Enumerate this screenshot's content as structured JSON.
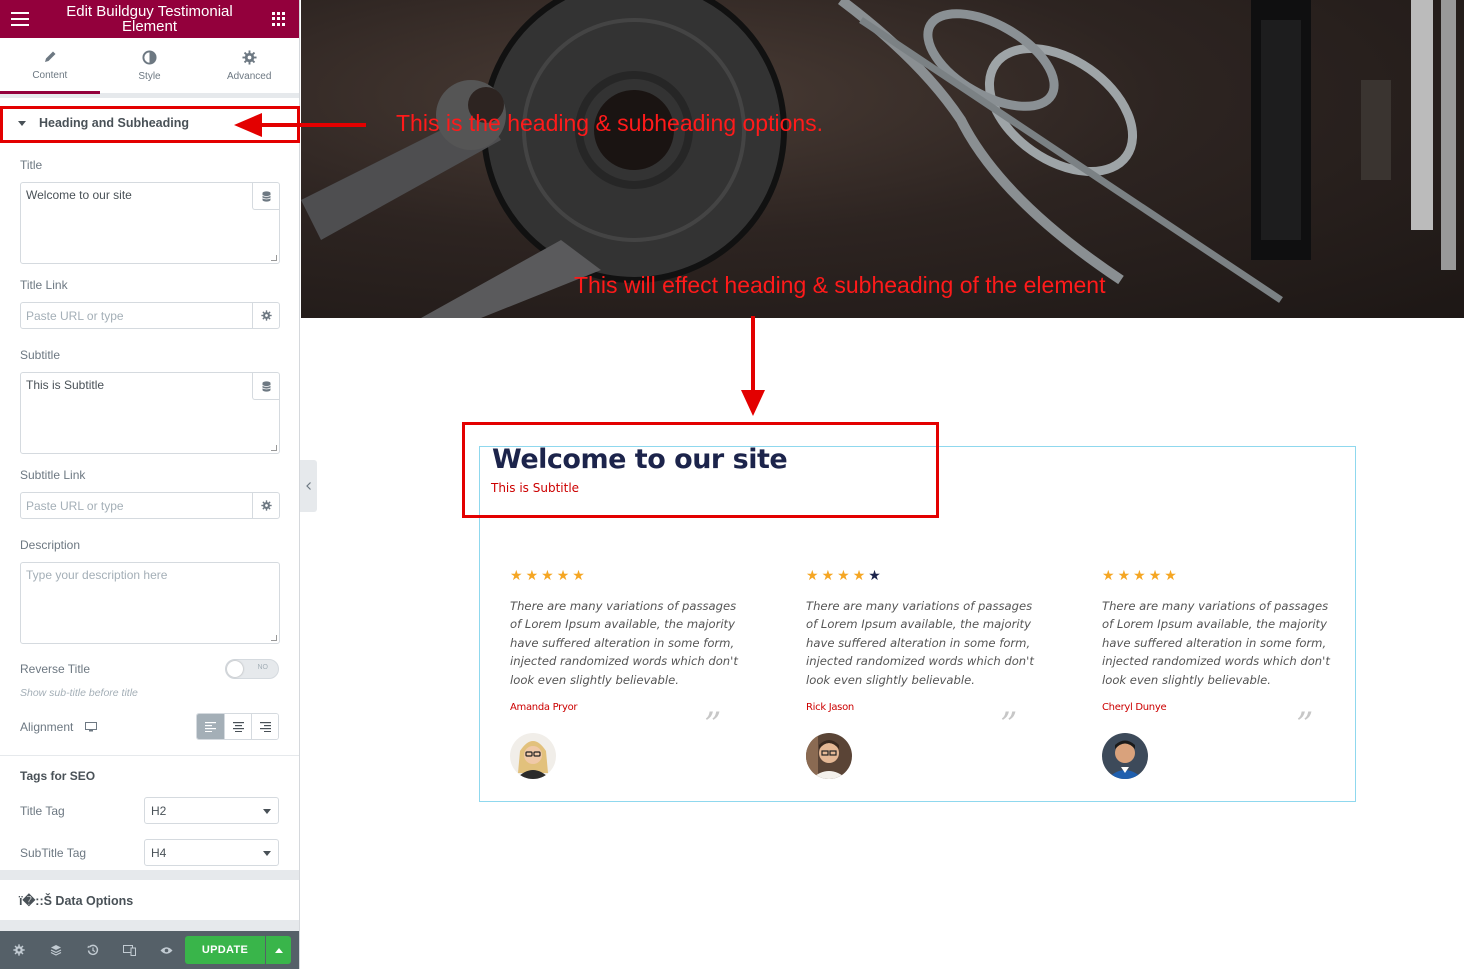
{
  "panel": {
    "header_title": "Edit Buildguy Testimonial Element",
    "tabs": [
      {
        "label": "Content",
        "icon": "pencil-icon"
      },
      {
        "label": "Style",
        "icon": "half-circle-icon"
      },
      {
        "label": "Advanced",
        "icon": "gear-icon"
      }
    ],
    "section_heading": "Heading and Subheading",
    "title_label": "Title",
    "title_value": "Welcome to our site",
    "title_link_label": "Title Link",
    "title_link_placeholder": "Paste URL or type",
    "subtitle_label": "Subtitle",
    "subtitle_value": "This is Subtitle",
    "subtitle_link_label": "Subtitle Link",
    "subtitle_link_placeholder": "Paste URL or type",
    "description_label": "Description",
    "description_placeholder": "Type your description here",
    "reverse_title_label": "Reverse Title",
    "reverse_title_toggle": "NO",
    "reverse_title_hint": "Show sub-title before title",
    "alignment_label": "Alignment",
    "tags_heading": "Tags for SEO",
    "title_tag_label": "Title Tag",
    "title_tag_value": "H2",
    "subtitle_tag_label": "SubTitle Tag",
    "subtitle_tag_value": "H4",
    "data_options_heading": "ï�::Š Data Options",
    "update_label": "UPDATE"
  },
  "preview": {
    "title": "Welcome to our site",
    "subtitle": "This is Subtitle",
    "testimonials": [
      {
        "rating": 5,
        "text": "There are many variations of passages of Lorem Ipsum available, the majority have suffered alteration in some form, injected randomized words which don't look even slightly believable.",
        "author": "Amanda Pryor",
        "quote_mark": "”"
      },
      {
        "rating": 4,
        "text": "There are many variations of passages of Lorem Ipsum available, the majority have suffered alteration in some form, injected randomized words which don't look even slightly believable.",
        "author": "Rick Jason",
        "quote_mark": "”"
      },
      {
        "rating": 5,
        "text": "There are many variations of passages of Lorem Ipsum available, the majority have suffered alteration in some form, injected randomized words which don't look even slightly believable.",
        "author": "Cheryl Dunye",
        "quote_mark": "”"
      }
    ]
  },
  "annotations": {
    "heading_options": "This is the heading & subheading options.",
    "effect_note": "This will effect heading & subheading of the element"
  },
  "colors": {
    "brand": "#93003c",
    "update_green": "#39b54a",
    "annotation_red": "#e30000",
    "star_gold": "#f5a623",
    "star_empty": "#1c244b",
    "title_navy": "#1c244b",
    "subtitle_red": "#cc0000",
    "box_border": "#8fd8ee"
  }
}
